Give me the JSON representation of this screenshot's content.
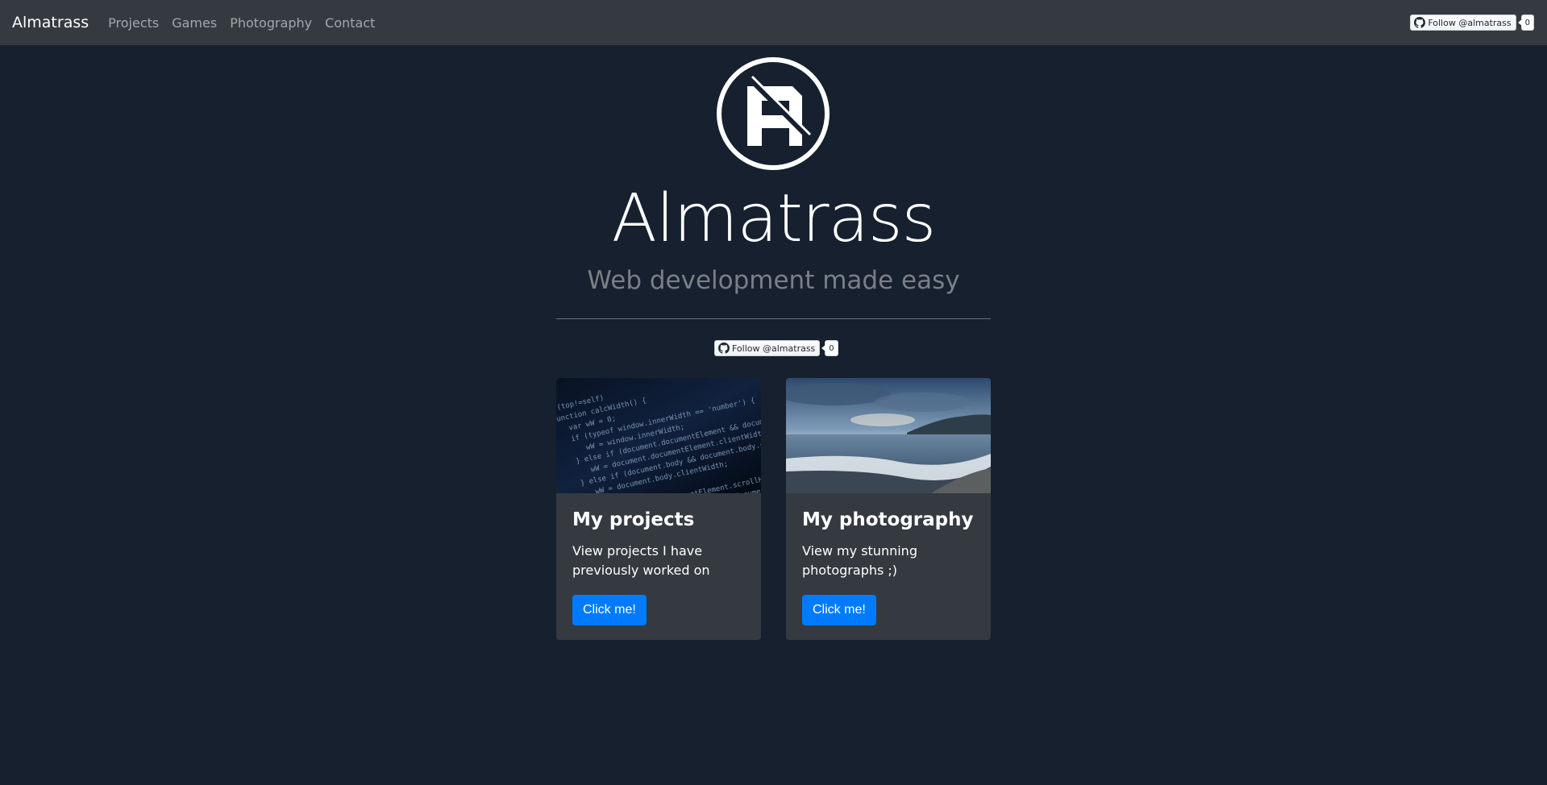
{
  "navbar": {
    "brand": "Almatrass",
    "links": [
      "Projects",
      "Games",
      "Photography",
      "Contact"
    ],
    "follow": {
      "label": "Follow @almatrass",
      "count": "0",
      "icon": "github-icon"
    }
  },
  "hero": {
    "title": "Almatrass",
    "subtitle": "Web development made easy",
    "follow": {
      "label": "Follow @almatrass",
      "count": "0",
      "icon": "github-icon"
    }
  },
  "cards": [
    {
      "title": "My projects",
      "text": "View projects I have previously worked on",
      "button": "Click me!",
      "image": "code-screenshot"
    },
    {
      "title": "My photography",
      "text": "View my stunning photographs ;)",
      "button": "Click me!",
      "image": "beach-photo"
    }
  ],
  "colors": {
    "background": "#17202f",
    "navbar": "#343a40",
    "card": "#343a40",
    "accent": "#007bff",
    "subtitle": "#7b7f86"
  }
}
